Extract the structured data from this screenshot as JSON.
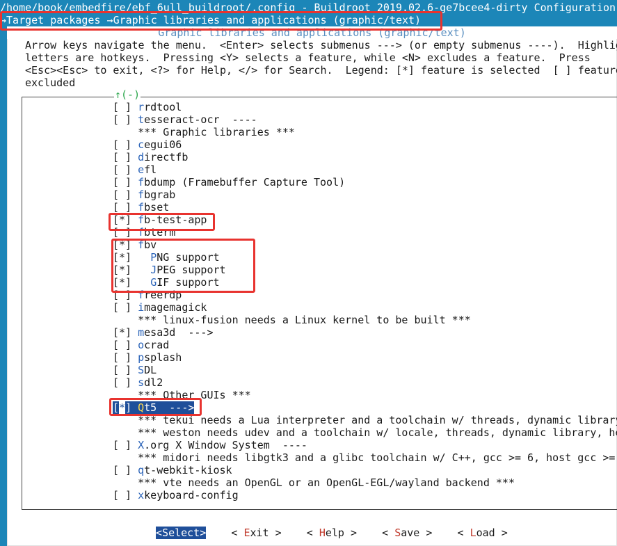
{
  "window": {
    "title": "/home/book/embedfire/ebf_6ull_buildroot/.config - Buildroot 2019.02.6-ge7bcee4-dirty Configuration"
  },
  "breadcrumb": {
    "arrow1": "→",
    "part1": "Target packages ",
    "arrow2": "→",
    "part2": "Graphic libraries and applications (graphic/text)"
  },
  "dialog": {
    "title": "Graphic libraries and applications (graphic/text)",
    "help_lines": [
      "Arrow keys navigate the menu.  <Enter> selects submenus ---> (or empty submenus ----).  Highlig",
      "letters are hotkeys.  Pressing <Y> selects a feature, while <N> excludes a feature.  Press",
      "<Esc><Esc> to exit, <?> for Help, </> for Search.  Legend: [*] feature is selected  [ ] feature",
      "excluded"
    ],
    "scroll_indicator": "↑(-)"
  },
  "menu": {
    "items": [
      {
        "box": "[ ] ",
        "indent": "",
        "hotkey": "r",
        "rest": "rdtool"
      },
      {
        "box": "[ ] ",
        "indent": "",
        "hotkey": "t",
        "rest": "esseract-ocr  ----"
      },
      {
        "box": "    ",
        "indent": "",
        "hotkey": "",
        "rest": "*** Graphic libraries ***"
      },
      {
        "box": "[ ] ",
        "indent": "",
        "hotkey": "c",
        "rest": "egui06"
      },
      {
        "box": "[ ] ",
        "indent": "",
        "hotkey": "d",
        "rest": "irectfb"
      },
      {
        "box": "[ ] ",
        "indent": "",
        "hotkey": "e",
        "rest": "fl"
      },
      {
        "box": "[ ] ",
        "indent": "",
        "hotkey": "f",
        "rest": "bdump (Framebuffer Capture Tool)"
      },
      {
        "box": "[ ] ",
        "indent": "",
        "hotkey": "f",
        "rest": "bgrab"
      },
      {
        "box": "[ ] ",
        "indent": "",
        "hotkey": "f",
        "rest": "bset"
      },
      {
        "box": "[*] ",
        "indent": "",
        "hotkey": "f",
        "rest": "b-test-app"
      },
      {
        "box": "[ ] ",
        "indent": "",
        "hotkey": "f",
        "rest": "bterm"
      },
      {
        "box": "[*] ",
        "indent": "",
        "hotkey": "f",
        "rest": "bv"
      },
      {
        "box": "[*] ",
        "indent": "  ",
        "hotkey": "P",
        "rest": "NG support"
      },
      {
        "box": "[*] ",
        "indent": "  ",
        "hotkey": "J",
        "rest": "PEG support"
      },
      {
        "box": "[*] ",
        "indent": "  ",
        "hotkey": "G",
        "rest": "IF support"
      },
      {
        "box": "[ ] ",
        "indent": "",
        "hotkey": "f",
        "rest": "reerdp"
      },
      {
        "box": "[ ] ",
        "indent": "",
        "hotkey": "i",
        "rest": "magemagick"
      },
      {
        "box": "    ",
        "indent": "",
        "hotkey": "",
        "rest": "*** linux-fusion needs a Linux kernel to be built ***"
      },
      {
        "box": "[*] ",
        "indent": "",
        "hotkey": "m",
        "rest": "esa3d  --->"
      },
      {
        "box": "[ ] ",
        "indent": "",
        "hotkey": "o",
        "rest": "crad"
      },
      {
        "box": "[ ] ",
        "indent": "",
        "hotkey": "p",
        "rest": "splash"
      },
      {
        "box": "[ ] ",
        "indent": "",
        "hotkey": "S",
        "rest": "DL"
      },
      {
        "box": "[ ] ",
        "indent": "",
        "hotkey": "s",
        "rest": "dl2"
      },
      {
        "box": "    ",
        "indent": "",
        "hotkey": "",
        "rest": "*** Other GUIs ***"
      },
      {
        "box": "",
        "indent": "",
        "hotkey": "Q",
        "rest": "t5  --->",
        "selected": true,
        "box_open": "[",
        "box_cursor": "*",
        "box_close": "] "
      },
      {
        "box": "    ",
        "indent": "",
        "hotkey": "",
        "rest": "*** tekui needs a Lua interpreter and a toolchain w/ threads, dynamic library"
      },
      {
        "box": "    ",
        "indent": "",
        "hotkey": "",
        "rest": "*** weston needs udev and a toolchain w/ locale, threads, dynamic library, he"
      },
      {
        "box": "[ ] ",
        "indent": "",
        "hotkey": "X",
        "rest": ".org X Window System  ----"
      },
      {
        "box": "    ",
        "indent": "",
        "hotkey": "",
        "rest": "*** midori needs libgtk3 and a glibc toolchain w/ C++, gcc >= 6, host gcc >="
      },
      {
        "box": "[ ] ",
        "indent": "",
        "hotkey": "q",
        "rest": "t-webkit-kiosk"
      },
      {
        "box": "    ",
        "indent": "",
        "hotkey": "",
        "rest": "*** vte needs an OpenGL or an OpenGL-EGL/wayland backend ***"
      },
      {
        "box": "[ ] ",
        "indent": "",
        "hotkey": "x",
        "rest": "keyboard-config"
      }
    ]
  },
  "buttons": {
    "select": {
      "open": "<",
      "hotkey": "S",
      "rest": "elect",
      "close": ">"
    },
    "exit": {
      "open": "< ",
      "hotkey": "E",
      "rest": "xit",
      "close": " >"
    },
    "help": {
      "open": "< ",
      "hotkey": "H",
      "rest": "elp",
      "close": " >"
    },
    "save": {
      "open": "< ",
      "hotkey": "S",
      "rest": "ave",
      "close": " >"
    },
    "load": {
      "open": "< ",
      "hotkey": "L",
      "rest": "oad",
      "close": " >"
    }
  },
  "colors": {
    "background": "#1c86b8",
    "dialog": "#ffffff",
    "hotkey": "#2a63b8",
    "selection": "#1f4f9a",
    "annotation": "#e8332f"
  }
}
